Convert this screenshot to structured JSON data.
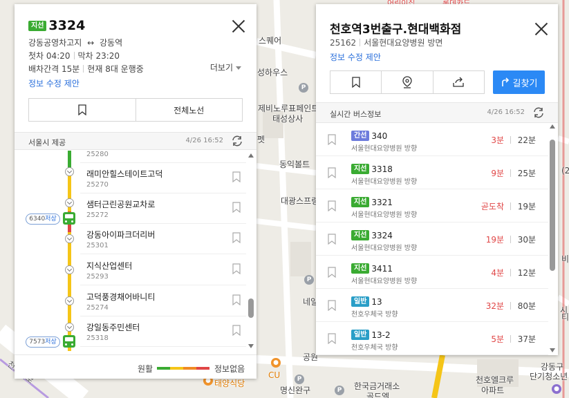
{
  "map": {
    "labels": [
      "스퀘어",
      "성하우스",
      "제비노루표페인트",
      "태성상사",
      "펫",
      "동익볼트",
      "대광스프링",
      "네일",
      "공원",
      "CU",
      "태양식당",
      "명신완구",
      "한국금거래소",
      "골드엘",
      "천호엘크루",
      "아파트",
      "강동구",
      "단기청소년",
      "천호대로",
      "어린이집",
      "롯데카드",
      "시",
      "(2",
      "비",
      "티"
    ]
  },
  "route_panel": {
    "badge": "지선",
    "number": "3324",
    "start": "강동공영차고지",
    "arrow": "↔",
    "end": "강동역",
    "first_label": "첫차",
    "first_time": "04:20",
    "last_label": "막차",
    "last_time": "23:20",
    "interval": "배차간격 15분",
    "operating": "현재 8대 운행중",
    "more": "더보기",
    "edit": "정보 수정 제안",
    "full_route": "전체노선",
    "provider": "서울시 제공",
    "updated": "4/26 16:52",
    "stops": [
      {
        "name": "",
        "id": "25280"
      },
      {
        "name": "래미안힐스테이트고덕",
        "id": "25270"
      },
      {
        "name": "샘터근린공원교차로",
        "id": "25272"
      },
      {
        "name": "강동아이파크더리버",
        "id": "25301"
      },
      {
        "name": "지식산업센터",
        "id": "25293"
      },
      {
        "name": "고덕풍경채어바니티",
        "id": "25274"
      },
      {
        "name": "강일동주민센터",
        "id": "25318"
      },
      {
        "name": "",
        "id": ""
      }
    ],
    "buses": [
      {
        "plate": "6340",
        "low": "저상"
      },
      {
        "plate": "7573",
        "low": "저상"
      }
    ],
    "legend_smooth": "원활",
    "legend_none": "정보없음",
    "legend_colors": [
      "#3aab32",
      "#f5c518",
      "#f08a24",
      "#e04646"
    ]
  },
  "stop_panel": {
    "title": "천호역3번출구.현대백화점",
    "stop_id": "25162",
    "direction": "서울현대요양병원 방면",
    "edit": "정보 수정 제안",
    "go": "길찾기",
    "realtime": "실시간 버스정보",
    "updated": "4/26 16:52",
    "buses": [
      {
        "type": "간선",
        "color": "blue",
        "num": "340",
        "dir": "서울현대요양병원 방향",
        "eta": "3분",
        "next": "22분"
      },
      {
        "type": "지선",
        "color": "green",
        "num": "3318",
        "dir": "서울현대요양병원 방향",
        "eta": "9분",
        "next": "25분"
      },
      {
        "type": "지선",
        "color": "green",
        "num": "3321",
        "dir": "서울현대요양병원 방향",
        "eta": "곧도착",
        "next": "19분"
      },
      {
        "type": "지선",
        "color": "green",
        "num": "3324",
        "dir": "서울현대요양병원 방향",
        "eta": "19분",
        "next": "30분"
      },
      {
        "type": "지선",
        "color": "green",
        "num": "3411",
        "dir": "서울현대요양병원 방향",
        "eta": "4분",
        "next": "12분"
      },
      {
        "type": "일반",
        "color": "teal",
        "num": "13",
        "dir": "천호우체국 방향",
        "eta": "32분",
        "next": "80분"
      },
      {
        "type": "일반",
        "color": "teal",
        "num": "13-2",
        "dir": "천호우체국 방향",
        "eta": "5분",
        "next": "37분"
      }
    ]
  }
}
